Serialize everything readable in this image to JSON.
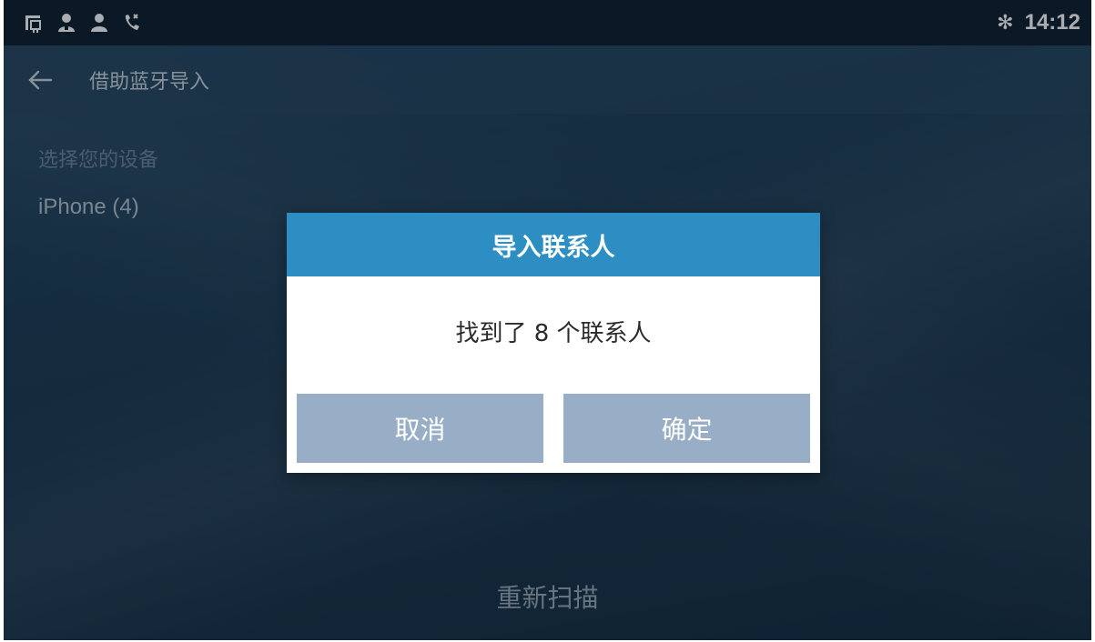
{
  "status_bar": {
    "icons": [
      "network-port-icon",
      "account-icon",
      "contact-icon",
      "missed-call-icon"
    ],
    "bluetooth_symbol": "✻",
    "time": "14:12"
  },
  "header": {
    "back_icon": "arrow-left-icon",
    "title": "借助蓝牙导入"
  },
  "main": {
    "section_label": "选择您的设备",
    "devices": [
      {
        "label": "iPhone (4)"
      }
    ],
    "rescan_label": "重新扫描"
  },
  "dialog": {
    "title": "导入联系人",
    "message": "找到了 8 个联系人",
    "cancel_label": "取消",
    "confirm_label": "确定"
  },
  "colors": {
    "dialog_header": "#2d8ec4",
    "dialog_button": "#98aec6",
    "status_bar": "#0d1c2c",
    "background": "#1d3b53"
  }
}
